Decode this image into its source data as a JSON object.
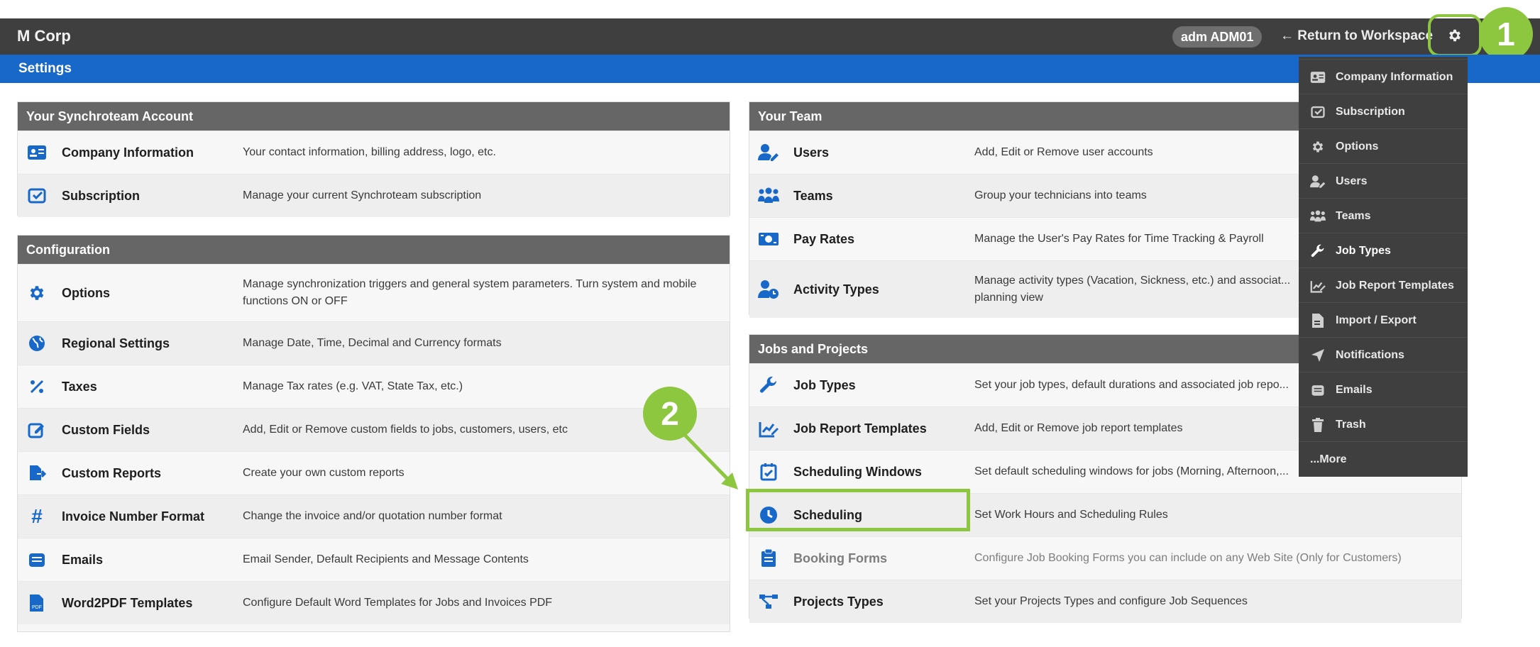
{
  "header": {
    "brand": "M Corp",
    "user_badge": "adm ADM01",
    "return_label": "Return to Workspace",
    "gear_icon": "gear-icon",
    "marker_1": "1"
  },
  "settings_bar": {
    "title": "Settings"
  },
  "colors": {
    "accent_blue": "#1868c9",
    "highlight_green": "#8dc63f",
    "topbar": "#3f3f3f",
    "panel_header": "#666666"
  },
  "panels": {
    "account": {
      "title": "Your Synchroteam Account",
      "rows": [
        {
          "icon": "id-card-icon",
          "title": "Company Information",
          "desc": "Your contact information, billing address, logo, etc."
        },
        {
          "icon": "subscription-icon",
          "title": "Subscription",
          "desc": "Manage your current Synchroteam subscription"
        }
      ]
    },
    "configuration": {
      "title": "Configuration",
      "rows": [
        {
          "icon": "gear-icon",
          "title": "Options",
          "desc": "Manage synchronization triggers and general system parameters. Turn system and mobile functions ON or OFF"
        },
        {
          "icon": "globe-icon",
          "title": "Regional Settings",
          "desc": "Manage Date, Time, Decimal and Currency formats"
        },
        {
          "icon": "percent-icon",
          "title": "Taxes",
          "desc": "Manage Tax rates (e.g. VAT, State Tax, etc.)"
        },
        {
          "icon": "edit-icon",
          "title": "Custom Fields",
          "desc": "Add, Edit or Remove custom fields to jobs, customers, users, etc"
        },
        {
          "icon": "file-export-icon",
          "title": "Custom Reports",
          "desc": "Create your own custom reports"
        },
        {
          "icon": "hash-icon",
          "title": "Invoice Number Format",
          "desc": "Change the invoice and/or quotation number format"
        },
        {
          "icon": "envelope-icon",
          "title": "Emails",
          "desc": "Email Sender, Default Recipients and Message Contents"
        },
        {
          "icon": "pdf-icon",
          "title": "Word2PDF Templates",
          "desc": "Configure Default Word Templates for Jobs and Invoices PDF"
        }
      ]
    },
    "team": {
      "title": "Your Team",
      "rows": [
        {
          "icon": "user-edit-icon",
          "title": "Users",
          "desc": "Add, Edit or Remove user accounts"
        },
        {
          "icon": "team-icon",
          "title": "Teams",
          "desc": "Group your technicians into teams"
        },
        {
          "icon": "money-icon",
          "title": "Pay Rates",
          "desc": "Manage the User's Pay Rates for Time Tracking & Payroll"
        },
        {
          "icon": "user-clock-icon",
          "title": "Activity Types",
          "desc": "Manage activity types (Vacation, Sickness, etc.) and associat... planning view"
        }
      ]
    },
    "jobs": {
      "title": "Jobs and Projects",
      "rows": [
        {
          "icon": "wrench-icon",
          "title": "Job Types",
          "desc": "Set your job types, default durations and associated job repo..."
        },
        {
          "icon": "report-edit-icon",
          "title": "Job Report Templates",
          "desc": "Add, Edit or Remove job report templates"
        },
        {
          "icon": "calendar-check-icon",
          "title": "Scheduling Windows",
          "desc": "Set default scheduling windows for jobs (Morning, Afternoon,..."
        },
        {
          "icon": "clock-icon",
          "title": "Scheduling",
          "desc": "Set Work Hours and Scheduling Rules"
        },
        {
          "icon": "clipboard-icon",
          "title": "Booking Forms",
          "desc": "Configure Job Booking Forms you can include on any Web Site (Only for Customers)"
        },
        {
          "icon": "project-diagram-icon",
          "title": "Projects Types",
          "desc": "Set your Projects Types and configure Job Sequences"
        }
      ]
    }
  },
  "annotations": {
    "marker_2": "2"
  },
  "dropdown": {
    "items": [
      {
        "icon": "id-card-icon",
        "label": "Company Information"
      },
      {
        "icon": "subscription-icon",
        "label": "Subscription"
      },
      {
        "icon": "gear-icon",
        "label": "Options"
      },
      {
        "icon": "user-edit-icon",
        "label": "Users"
      },
      {
        "icon": "team-icon",
        "label": "Teams"
      },
      {
        "icon": "wrench-icon",
        "label": "Job Types"
      },
      {
        "icon": "report-edit-icon",
        "label": "Job Report Templates"
      },
      {
        "icon": "file-import-icon",
        "label": "Import / Export"
      },
      {
        "icon": "paper-plane-icon",
        "label": "Notifications"
      },
      {
        "icon": "inbox-icon",
        "label": "Emails"
      },
      {
        "icon": "trash-icon",
        "label": "Trash"
      }
    ],
    "more_label": "...More"
  }
}
